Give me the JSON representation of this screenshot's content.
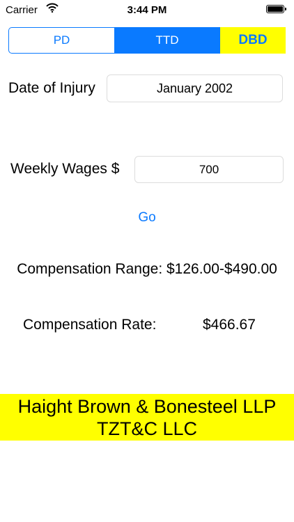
{
  "status_bar": {
    "carrier": "Carrier",
    "time": "3:44 PM",
    "icons": [
      "wifi-icon",
      "battery-icon"
    ]
  },
  "segmented_control": {
    "segments": [
      "PD",
      "TTD",
      "DBD"
    ],
    "selected": "TTD",
    "colors": {
      "accent": "#0a7aff",
      "highlight": "#ffff00"
    }
  },
  "date_of_injury": {
    "label": "Date of Injury",
    "value": "January 2002"
  },
  "weekly_wages": {
    "label": "Weekly Wages $",
    "value": "700"
  },
  "go_button": {
    "label": "Go"
  },
  "results": {
    "range_label": "Compensation Range:",
    "range_value": "$126.00-$490.00",
    "rate_label": "Compensation Rate:",
    "rate_value": "$466.67"
  },
  "footer": {
    "line1": "Haight Brown & Bonesteel LLP",
    "line2": "TZT&C LLC",
    "background": "#ffff00"
  }
}
